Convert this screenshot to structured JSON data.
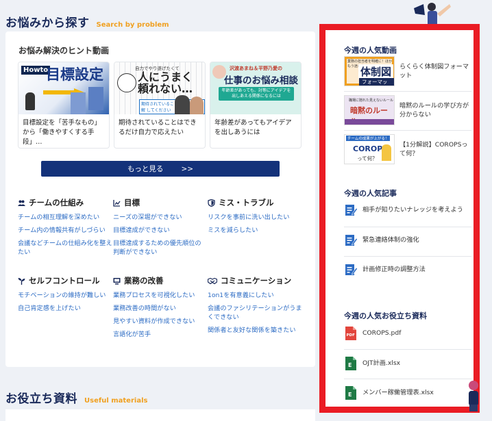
{
  "sections": {
    "problems": {
      "title_jp": "お悩みから探す",
      "title_en": "Search by problem"
    },
    "materials": {
      "title_jp": "お役立ち資料",
      "title_en": "Useful materials"
    }
  },
  "hint_videos": {
    "title": "お悩み解決のヒント動画",
    "items": [
      {
        "title": "目標設定を「苦手なもの」から「働きやすくする手段」…",
        "thumb_badge": "Howto",
        "thumb_text": "目標設定"
      },
      {
        "title": "期待されていることはできるだけ自力で応えたい",
        "thumb_tagline": "自力でやり遂げたくて",
        "thumb_text": "人にうまく頼れない…",
        "thumb_sub": "期待されていることは自力で 分解 してください"
      },
      {
        "title": "年齢差があってもアイデアを出しあうには",
        "thumb_names": "沢渡あまね＆平野乃愛の",
        "thumb_text": "仕事のお悩み相談室",
        "thumb_banner": "年齢差があっても、対等にアイデアを出しあえる関係になるには"
      }
    ],
    "more_label": "もっと見る",
    "more_arrow": ">>"
  },
  "categories": [
    {
      "icon": "team-icon",
      "title": "チームの仕組み",
      "links": [
        "チームの相互理解を深めたい",
        "チーム内の情報共有がしづらい",
        "会議などチームの仕組み化を整えたい"
      ]
    },
    {
      "icon": "chart-icon",
      "title": "目標",
      "links": [
        "ニーズの深堀ができない",
        "目標達成ができない",
        "目標達成するための優先順位の判断ができない"
      ]
    },
    {
      "icon": "shield-icon",
      "title": "ミス・トラブル",
      "links": [
        "リスクを事前に洗い出したい",
        "ミスを減らしたい"
      ]
    },
    {
      "icon": "sprout-icon",
      "title": "セルフコントロール",
      "links": [
        "モチベーションの維持が難しい",
        "自己肯定感を上げたい"
      ]
    },
    {
      "icon": "monitor-icon",
      "title": "業務の改善",
      "links": [
        "業務プロセスを可視化したい",
        "業務改善の時間がない",
        "見やすい資料が作成できない",
        "言語化が苦手"
      ]
    },
    {
      "icon": "handshake-icon",
      "title": "コミュニケーション",
      "links": [
        "1on1を有意義にしたい",
        "会議のファシリテーションがうまくできない",
        "関係者と友好な関係を築きたい"
      ]
    }
  ],
  "sidebar": {
    "videos": {
      "title": "今週の人気動画",
      "items": [
        {
          "title": "らくらく体制図フォーマット",
          "thumb_top": "業務の担当者を明確に！ほかもう迷わない",
          "thumb_big": "体制図",
          "thumb_sub": "フォーマット"
        },
        {
          "title": "暗黙のルールの学び方が分からない",
          "thumb_top": "職場に隠れた見えないルール",
          "thumb_big": "暗黙のルール"
        },
        {
          "title": "【1分解説】COROPSって何？",
          "thumb_top": "チームの成果が上がる！",
          "thumb_big": "COROPS",
          "thumb_sub": "って何？"
        }
      ]
    },
    "articles": {
      "title": "今週の人気記事",
      "items": [
        "相手が知りたいナレッジを考えよう",
        "緊急連絡体制の強化",
        "計画修正時の調整方法"
      ]
    },
    "materials": {
      "title": "今週の人気お役立ち資料",
      "items": [
        {
          "name": "COROPS.pdf",
          "type": "pdf"
        },
        {
          "name": "OJT計画.xlsx",
          "type": "excel"
        },
        {
          "name": "メンバー稼働管理表.xlsx",
          "type": "excel"
        }
      ]
    }
  },
  "colors": {
    "navy": "#14327a",
    "accent_orange": "#f0a020",
    "link_blue": "#2d6cc4",
    "highlight_red": "#ea1c24",
    "pdf_red": "#e2453c",
    "excel_green": "#1f7a45"
  }
}
